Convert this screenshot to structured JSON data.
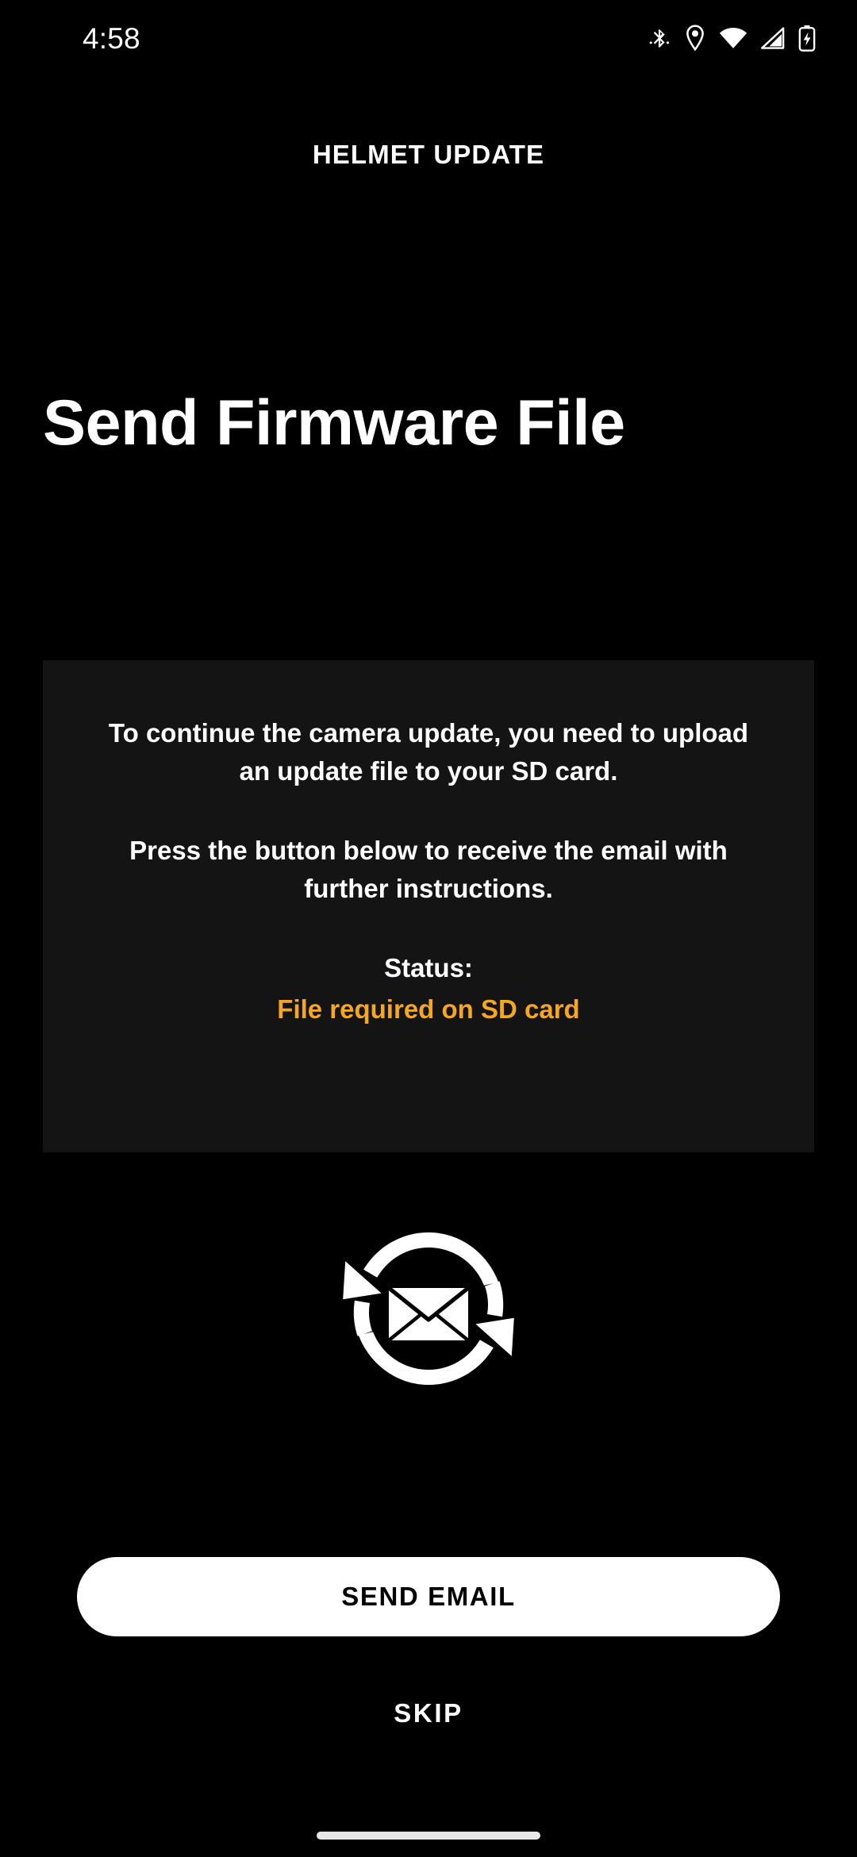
{
  "statusbar": {
    "clock": "4:58",
    "icons": [
      {
        "name": "bluetooth-icon",
        "label": "Bluetooth"
      },
      {
        "name": "location-pin-icon",
        "label": "Location"
      },
      {
        "name": "wifi-icon",
        "label": "Wi-Fi"
      },
      {
        "name": "cellular-signal-icon",
        "label": "Cellular signal"
      },
      {
        "name": "battery-charging-icon",
        "label": "Battery charging"
      }
    ]
  },
  "header": {
    "title": "HELMET UPDATE"
  },
  "main": {
    "heading": "Send Firmware File",
    "card": {
      "paragraph_1": "To continue the camera update, you need to upload an update file to your SD card.",
      "paragraph_2": "Press the button below to receive the email with further instructions.",
      "status_label": "Status:",
      "status_value": "File required on SD card"
    },
    "illustration": {
      "name": "sync-email-icon"
    }
  },
  "actions": {
    "primary_label": "SEND EMAIL",
    "secondary_label": "SKIP"
  },
  "colors": {
    "background": "#000000",
    "card_background": "#141414",
    "text_primary": "#ffffff",
    "status_warning": "#F5A623",
    "button_primary_bg": "#ffffff",
    "button_primary_text": "#000000",
    "home_indicator": "#e8e8e8"
  }
}
